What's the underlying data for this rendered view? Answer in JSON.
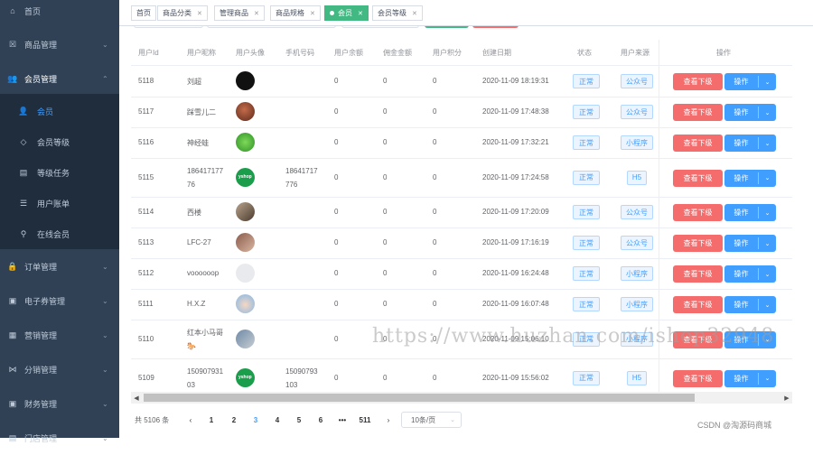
{
  "sidebar": {
    "menus": [
      {
        "label": "首页",
        "icon": "home-icon",
        "glyph": "⌂",
        "has_chevron": false
      },
      {
        "label": "商品管理",
        "icon": "goods-icon",
        "glyph": "☒",
        "has_chevron": true
      },
      {
        "label": "会员管理",
        "icon": "member-icon",
        "glyph": "👥",
        "has_chevron": true,
        "expanded": true
      }
    ],
    "submenus": [
      {
        "label": "会员",
        "icon": "user-icon",
        "glyph": "👤",
        "active": true
      },
      {
        "label": "会员等级",
        "icon": "level-icon",
        "glyph": "◇"
      },
      {
        "label": "等级任务",
        "icon": "task-icon",
        "glyph": "▤"
      },
      {
        "label": "用户账单",
        "icon": "bill-icon",
        "glyph": "☰"
      },
      {
        "label": "在线会员",
        "icon": "online-icon",
        "glyph": "⚲"
      }
    ],
    "menus_after": [
      {
        "label": "订单管理",
        "icon": "order-icon",
        "glyph": "🔒"
      },
      {
        "label": "电子券管理",
        "icon": "coupon-icon",
        "glyph": "▣"
      },
      {
        "label": "营销管理",
        "icon": "marketing-icon",
        "glyph": "▦"
      },
      {
        "label": "分销管理",
        "icon": "distribution-icon",
        "glyph": "⋈"
      },
      {
        "label": "财务管理",
        "icon": "finance-icon",
        "glyph": "▣"
      },
      {
        "label": "门店管理",
        "icon": "store-icon",
        "glyph": "▤"
      }
    ]
  },
  "tabs": [
    {
      "label": "首页",
      "closable": false
    },
    {
      "label": "商品分类",
      "closable": true
    },
    {
      "label": "管理商品",
      "closable": true
    },
    {
      "label": "商品规格",
      "closable": true
    },
    {
      "label": "会员",
      "closable": true,
      "active": true
    },
    {
      "label": "会员等级",
      "closable": true
    }
  ],
  "table": {
    "columns": [
      "用户Id",
      "用户昵称",
      "用户头像",
      "手机号码",
      "用户余额",
      "佣金金额",
      "用户积分",
      "创建日期",
      "状态",
      "用户来源",
      "操作"
    ],
    "rows": [
      {
        "id": "5118",
        "nick": "刘超",
        "avatar": "dark",
        "phone": "",
        "balance": "0",
        "commission": "0",
        "points": "0",
        "date": "2020-11-09 18:19:31",
        "status": "正常",
        "source": "公众号"
      },
      {
        "id": "5117",
        "nick": "踩雪儿二",
        "avatar": "brown",
        "phone": "",
        "balance": "0",
        "commission": "0",
        "points": "0",
        "date": "2020-11-09 17:48:38",
        "status": "正常",
        "source": "公众号"
      },
      {
        "id": "5116",
        "nick": "神经蛙",
        "avatar": "frog",
        "phone": "",
        "balance": "0",
        "commission": "0",
        "points": "0",
        "date": "2020-11-09 17:32:21",
        "status": "正常",
        "source": "小程序"
      },
      {
        "id": "5115",
        "nick": "18641717776",
        "avatar": "yshop",
        "phone": "18641717776",
        "balance": "0",
        "commission": "0",
        "points": "0",
        "date": "2020-11-09 17:24:58",
        "status": "正常",
        "source": "H5"
      },
      {
        "id": "5114",
        "nick": "西楼",
        "avatar": "photo1",
        "phone": "",
        "balance": "0",
        "commission": "0",
        "points": "0",
        "date": "2020-11-09 17:20:09",
        "status": "正常",
        "source": "公众号"
      },
      {
        "id": "5113",
        "nick": "LFC-27",
        "avatar": "photo2",
        "phone": "",
        "balance": "0",
        "commission": "0",
        "points": "0",
        "date": "2020-11-09 17:16:19",
        "status": "正常",
        "source": "公众号"
      },
      {
        "id": "5112",
        "nick": "voooooop",
        "avatar": "default",
        "phone": "",
        "balance": "0",
        "commission": "0",
        "points": "0",
        "date": "2020-11-09 16:24:48",
        "status": "正常",
        "source": "小程序"
      },
      {
        "id": "5111",
        "nick": "H.X.Z",
        "avatar": "cartoon",
        "phone": "",
        "balance": "0",
        "commission": "0",
        "points": "0",
        "date": "2020-11-09 16:07:48",
        "status": "正常",
        "source": "小程序"
      },
      {
        "id": "5110",
        "nick": "红本小马哥 🐎",
        "avatar": "photo3",
        "phone": "",
        "balance": "0",
        "commission": "0",
        "points": "0",
        "date": "2020-11-09 15:06:10",
        "status": "正常",
        "source": "小程序"
      },
      {
        "id": "5109",
        "nick": "15090793103",
        "avatar": "yshop",
        "phone": "15090793103",
        "balance": "0",
        "commission": "0",
        "points": "0",
        "date": "2020-11-09 15:56:02",
        "status": "正常",
        "source": "H5"
      }
    ],
    "action_view_label": "查看下级",
    "action_more_label": "操作"
  },
  "pagination": {
    "total_label": "共 5106 条",
    "pages": [
      "1",
      "2",
      "3",
      "4",
      "5",
      "6",
      "•••",
      "511"
    ],
    "current": "3",
    "page_size_label": "10条/页"
  },
  "overlay": {
    "watermark_text": "https://www.huzhan.com/ishop32948",
    "csdn_text": "CSDN @淘源码商城"
  },
  "colors": {
    "sidebar_bg": "#304156",
    "submenu_bg": "#1f2d3d",
    "accent": "#409eff",
    "danger": "#f56c6c",
    "active_tab": "#42b983"
  }
}
